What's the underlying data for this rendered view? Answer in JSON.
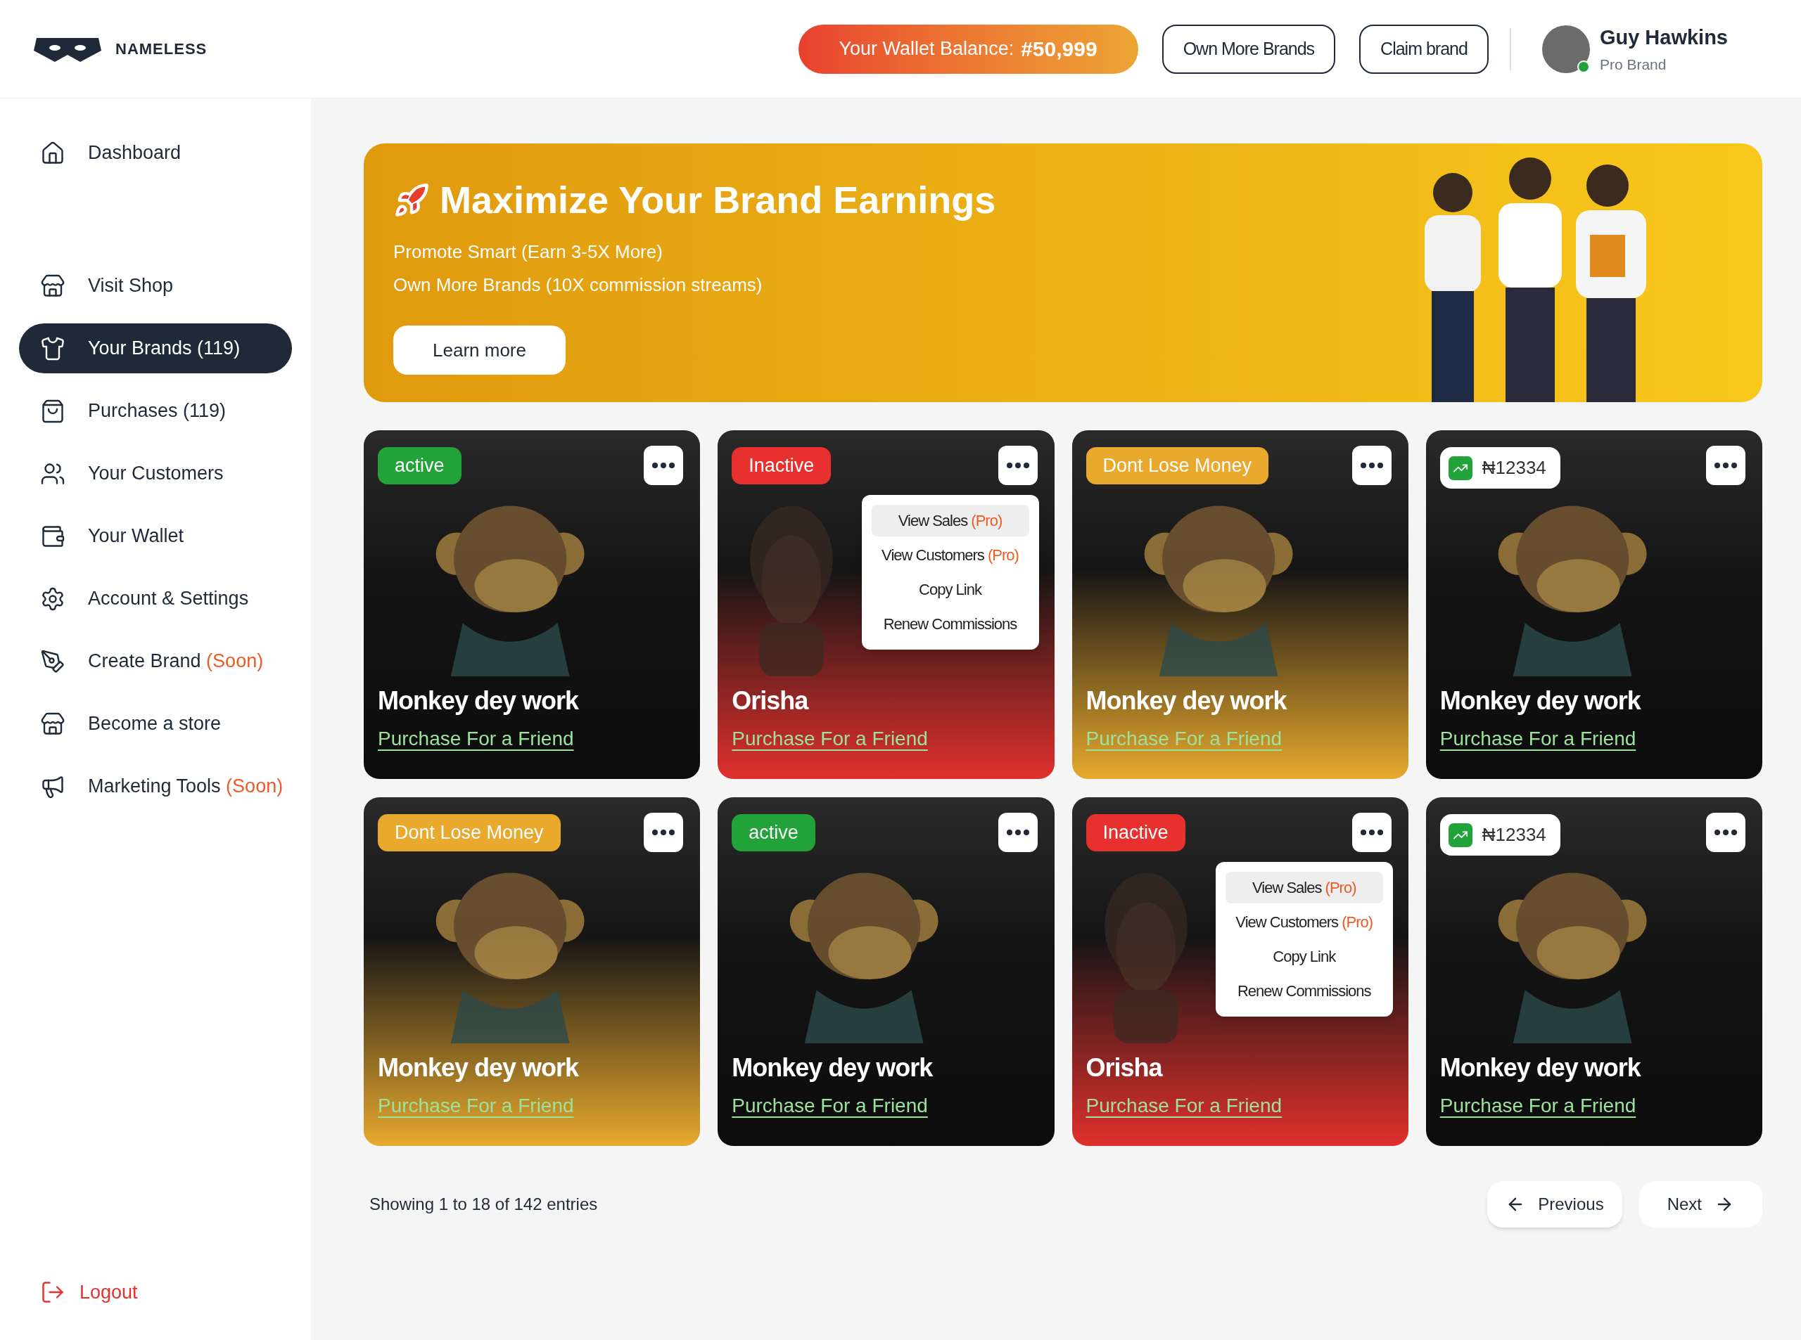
{
  "header": {
    "logo": "NAMELESS",
    "wallet": {
      "label": "Your Wallet Balance:",
      "amount": "#50,999"
    },
    "buttons": [
      "Own More Brands",
      "Claim brand"
    ],
    "user": {
      "name": "Guy Hawkins",
      "role": "Pro Brand",
      "online": true
    }
  },
  "sidebar": {
    "items": [
      {
        "label": "Dashboard",
        "selected": false
      },
      {
        "label": "Visit Shop",
        "selected": false
      },
      {
        "label": "Your Brands (119)",
        "selected": true
      },
      {
        "label": "Purchases (119)",
        "selected": false
      },
      {
        "label": "Your Customers",
        "selected": false
      },
      {
        "label": "Your Wallet",
        "selected": false
      },
      {
        "label": "Account & Settings",
        "selected": false
      },
      {
        "label": "Create Brand",
        "note": "(Soon)",
        "selected": false
      },
      {
        "label": "Become a store",
        "selected": false
      },
      {
        "label": "Marketing Tools",
        "note": "(Soon)",
        "selected": false
      }
    ],
    "logout": "Logout"
  },
  "banner": {
    "title": "Maximize Your Brand Earnings",
    "lines": [
      "Promote Smart (Earn 3-5X More)",
      "Own More Brands (10X commission streams)"
    ],
    "button": "Learn more"
  },
  "cards": [
    {
      "kind": "monkey",
      "color": "#0c0c0c",
      "badge": {
        "kind": "status",
        "text": "active",
        "color": "#22a33a"
      },
      "title": "Monkey dey work",
      "link": "Purchase For a Friend"
    },
    {
      "kind": "statue",
      "color": "#e0302d",
      "badge": {
        "kind": "status",
        "text": "Inactive",
        "color": "#e8302f"
      },
      "title": "Orisha",
      "link": "Purchase For a Friend",
      "menu": [
        {
          "label": "View Sales",
          "tag": "(Pro)",
          "selected": true
        },
        {
          "label": "View Customers",
          "tag": "(Pro)",
          "selected": false
        },
        {
          "label": "Copy Link",
          "selected": false
        },
        {
          "label": "Renew Commissions",
          "selected": false
        }
      ]
    },
    {
      "kind": "monkey",
      "color": "#e8a92e",
      "badge": {
        "kind": "status",
        "text": "Dont Lose Money",
        "color": "#e9a92c"
      },
      "title": "Monkey dey work",
      "link": "Purchase For a Friend"
    },
    {
      "kind": "monkey",
      "color": "#0c0c0c",
      "badge": {
        "kind": "amount",
        "text": "₦12334"
      },
      "title": "Monkey dey work",
      "link": "Purchase For a Friend"
    },
    {
      "kind": "monkey",
      "color": "#e8a92e",
      "badge": {
        "kind": "status",
        "text": "Dont Lose Money",
        "color": "#e9a92c"
      },
      "title": "Monkey dey work",
      "link": "Purchase For a Friend"
    },
    {
      "kind": "monkey",
      "color": "#0c0c0c",
      "badge": {
        "kind": "status",
        "text": "active",
        "color": "#22a33a"
      },
      "title": "Monkey dey work",
      "link": "Purchase For a Friend"
    },
    {
      "kind": "statue",
      "color": "#e0302d",
      "badge": {
        "kind": "status",
        "text": "Inactive",
        "color": "#e8302f"
      },
      "title": "Orisha",
      "link": "Purchase For a Friend",
      "menu": [
        {
          "label": "View Sales",
          "tag": "(Pro)",
          "selected": true
        },
        {
          "label": "View Customers",
          "tag": "(Pro)",
          "selected": false
        },
        {
          "label": "Copy Link",
          "selected": false
        },
        {
          "label": "Renew Commissions",
          "selected": false
        }
      ]
    },
    {
      "kind": "monkey",
      "color": "#0c0c0c",
      "badge": {
        "kind": "amount",
        "text": "₦12334"
      },
      "title": "Monkey dey work",
      "link": "Purchase For a Friend"
    }
  ],
  "pagination": {
    "summary": "Showing 1 to 18 of 142 entries",
    "previous": "Previous",
    "next": "Next"
  }
}
